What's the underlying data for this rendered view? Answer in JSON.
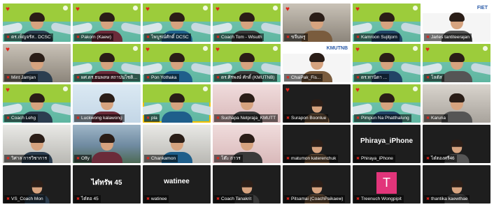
{
  "participants": [
    {
      "name": "ดร.เพ็ญจรัส.. DCSC",
      "bg": "teal",
      "heart": true
    },
    {
      "name": "Pakorn (Kaew)",
      "bg": "teal",
      "heart": true
    },
    {
      "name": "ไพบูรณ์ศักดิ์ DCSC",
      "bg": "teal",
      "heart": true
    },
    {
      "name": "Coach Tom - Wisuth",
      "bg": "teal",
      "heart": true
    },
    {
      "name": "ขจีนพรู",
      "bg": "room",
      "heart": true
    },
    {
      "name": "Kamroon Sujitjorn",
      "bg": "teal",
      "heart": true
    },
    {
      "name": "Jarles tantiteerajan",
      "bg": "white",
      "heart": false,
      "banner": "FIET"
    },
    {
      "name": "Mint Jamjan",
      "bg": "room",
      "heart": true
    },
    {
      "name": "ผศ.ดร.ธนพลษ สถาปนโชติเกียรติ",
      "bg": "teal",
      "heart": false
    },
    {
      "name": "Pon Yothaka",
      "bg": "teal",
      "heart": true
    },
    {
      "name": "ดร.ศิรพงษ์ ศักดิ์ (KMUTNB)",
      "bg": "teal",
      "heart": true
    },
    {
      "name": "ChaiPak_Fis...",
      "bg": "white",
      "heart": false,
      "banner": "KMUTNB"
    },
    {
      "name": "ดร.ทานิดา ...",
      "bg": "teal",
      "heart": true
    },
    {
      "name": "โลตัส",
      "bg": "teal",
      "heart": true
    },
    {
      "name": "Coach Lehg",
      "bg": "teal",
      "heart": true
    },
    {
      "name": "Luckwong kalawong",
      "bg": "cartoon",
      "heart": false
    },
    {
      "name": "pla",
      "bg": "teal",
      "heart": false,
      "speaker": true
    },
    {
      "name": "Suchapa Netpraja_KMUTT",
      "bg": "pink",
      "heart": false
    },
    {
      "name": "Surapon Boonlue",
      "bg": "dark",
      "heart": true
    },
    {
      "name": "Pimpun Na Phatthalung",
      "bg": "teal",
      "heart": true
    },
    {
      "name": "Karuna",
      "bg": "grey",
      "heart": false
    },
    {
      "name": "วิศาล การวิชาการ",
      "bg": "office",
      "heart": false
    },
    {
      "name": "Offy",
      "bg": "lake",
      "heart": false
    },
    {
      "name": "Chankamon",
      "bg": "office",
      "heart": false
    },
    {
      "name": "โต๊ะ ถาวร",
      "bg": "pink",
      "heart": false
    },
    {
      "name": "matumon katerenchuk",
      "bg": "dark",
      "heart": false
    },
    {
      "name": "Phiraya_iPhone",
      "bg": "dark",
      "heart": false,
      "center": "Phiraya_iPhone"
    },
    {
      "name": "ไต๋ตองศรี46",
      "bg": "dark",
      "heart": false
    },
    {
      "name": "VS_Coach Mon",
      "bg": "dark",
      "heart": false
    },
    {
      "name": "ไต๋ตอ 45",
      "bg": "dark",
      "heart": false,
      "center": "ไต๋ทรัพ 45"
    },
    {
      "name": "watinee",
      "bg": "dark",
      "heart": false,
      "center": "watinee"
    },
    {
      "name": "Coach Tanakrit",
      "bg": "dark",
      "heart": false
    },
    {
      "name": "Pitsamai (CoachPaikaew)",
      "bg": "dark",
      "heart": false
    },
    {
      "name": "Treenuch Wongpipit",
      "bg": "dark",
      "heart": false,
      "avatar_letter": "T"
    },
    {
      "name": "thantika kaewthae",
      "bg": "dark",
      "heart": false
    }
  ],
  "colors": {
    "accent_yellow": "#f2c200",
    "muted_red": "#e2231a",
    "avatar_pink": "#e2357a",
    "virtual_bg_teal": "#5fb6a1",
    "virtual_bg_lime": "#9ccc3b"
  },
  "icons": {
    "reaction": "heart-icon",
    "muted": "mic-muted-icon"
  }
}
